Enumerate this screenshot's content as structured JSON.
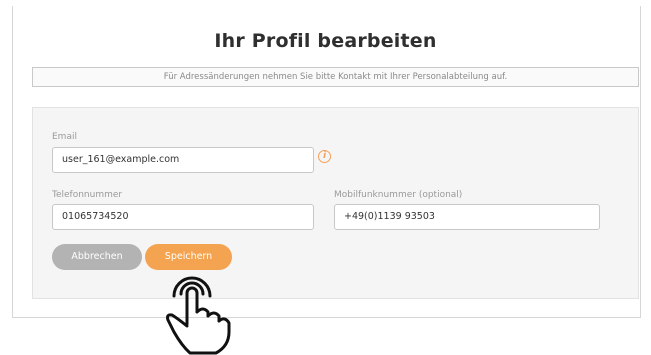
{
  "header": {
    "title": "Ihr Profil bearbeiten"
  },
  "notice": {
    "text": "Für Adressänderungen nehmen Sie bitte Kontakt mit Ihrer Personalabteilung auf."
  },
  "form": {
    "email": {
      "label": "Email",
      "value": "user_161@example.com",
      "warning_icon": "info-warning-icon"
    },
    "phone": {
      "label": "Telefonnummer",
      "value": "01065734520"
    },
    "mobile": {
      "label": "Mobilfunknummer (optional)",
      "value": "+49(0)1139 93503"
    }
  },
  "actions": {
    "cancel_label": "Abbrechen",
    "save_label": "Speichern"
  },
  "overlay": {
    "icon": "tap-hand-icon"
  },
  "colors": {
    "accent": "#f4a351",
    "cancel": "#b3b3b3",
    "warning": "#f4a05a"
  }
}
